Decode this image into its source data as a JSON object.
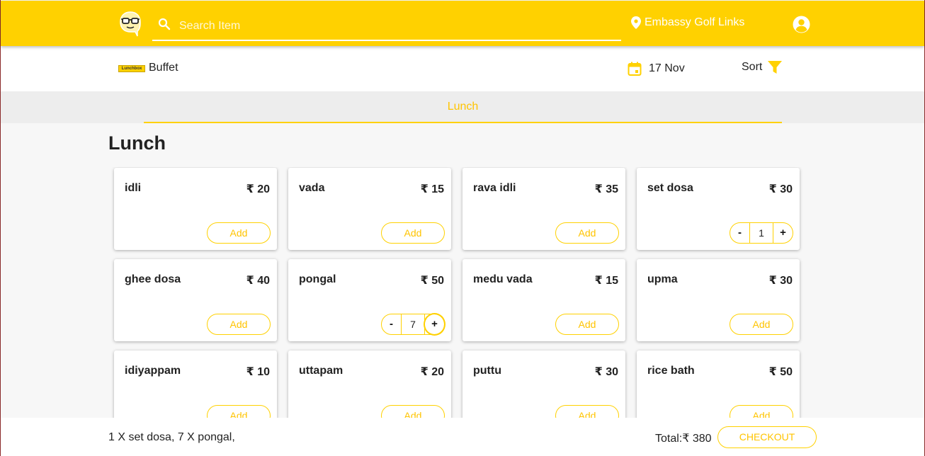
{
  "colors": {
    "accent": "#ffd100",
    "accent_text": "#ffc400"
  },
  "header": {
    "search_placeholder": "Search Item",
    "location": "Embassy Golf Links"
  },
  "subheader": {
    "brand_logo_text": "Lunchbox",
    "brand_name": "Buffet",
    "date": "17 Nov",
    "sort_label": "Sort"
  },
  "tabs": [
    {
      "label": "Lunch",
      "active": true
    }
  ],
  "section": {
    "title": "Lunch"
  },
  "items": [
    {
      "name": "idli",
      "price": "₹ 20",
      "quantity": 0
    },
    {
      "name": "vada",
      "price": "₹ 15",
      "quantity": 0
    },
    {
      "name": "rava idli",
      "price": "₹ 35",
      "quantity": 0
    },
    {
      "name": "set dosa",
      "price": "₹ 30",
      "quantity": 1
    },
    {
      "name": "ghee dosa",
      "price": "₹ 40",
      "quantity": 0
    },
    {
      "name": "pongal",
      "price": "₹ 50",
      "quantity": 7
    },
    {
      "name": "medu vada",
      "price": "₹ 15",
      "quantity": 0
    },
    {
      "name": "upma",
      "price": "₹ 30",
      "quantity": 0
    },
    {
      "name": "idiyappam",
      "price": "₹ 10",
      "quantity": 0
    },
    {
      "name": "uttapam",
      "price": "₹ 20",
      "quantity": 0
    },
    {
      "name": "puttu",
      "price": "₹ 30",
      "quantity": 0
    },
    {
      "name": "rice bath",
      "price": "₹ 50",
      "quantity": 0
    }
  ],
  "labels": {
    "add": "Add",
    "minus": "-",
    "plus": "+"
  },
  "footer": {
    "summary": "1 X set dosa, 7 X pongal,",
    "total": "Total:₹ 380",
    "checkout_label": "CHECKOUT"
  },
  "icons": {
    "logo": "glasses-face-logo-icon",
    "search": "search-icon",
    "location": "map-pin-icon",
    "user": "account-circle-icon",
    "calendar": "calendar-icon",
    "filter": "filter-icon"
  }
}
